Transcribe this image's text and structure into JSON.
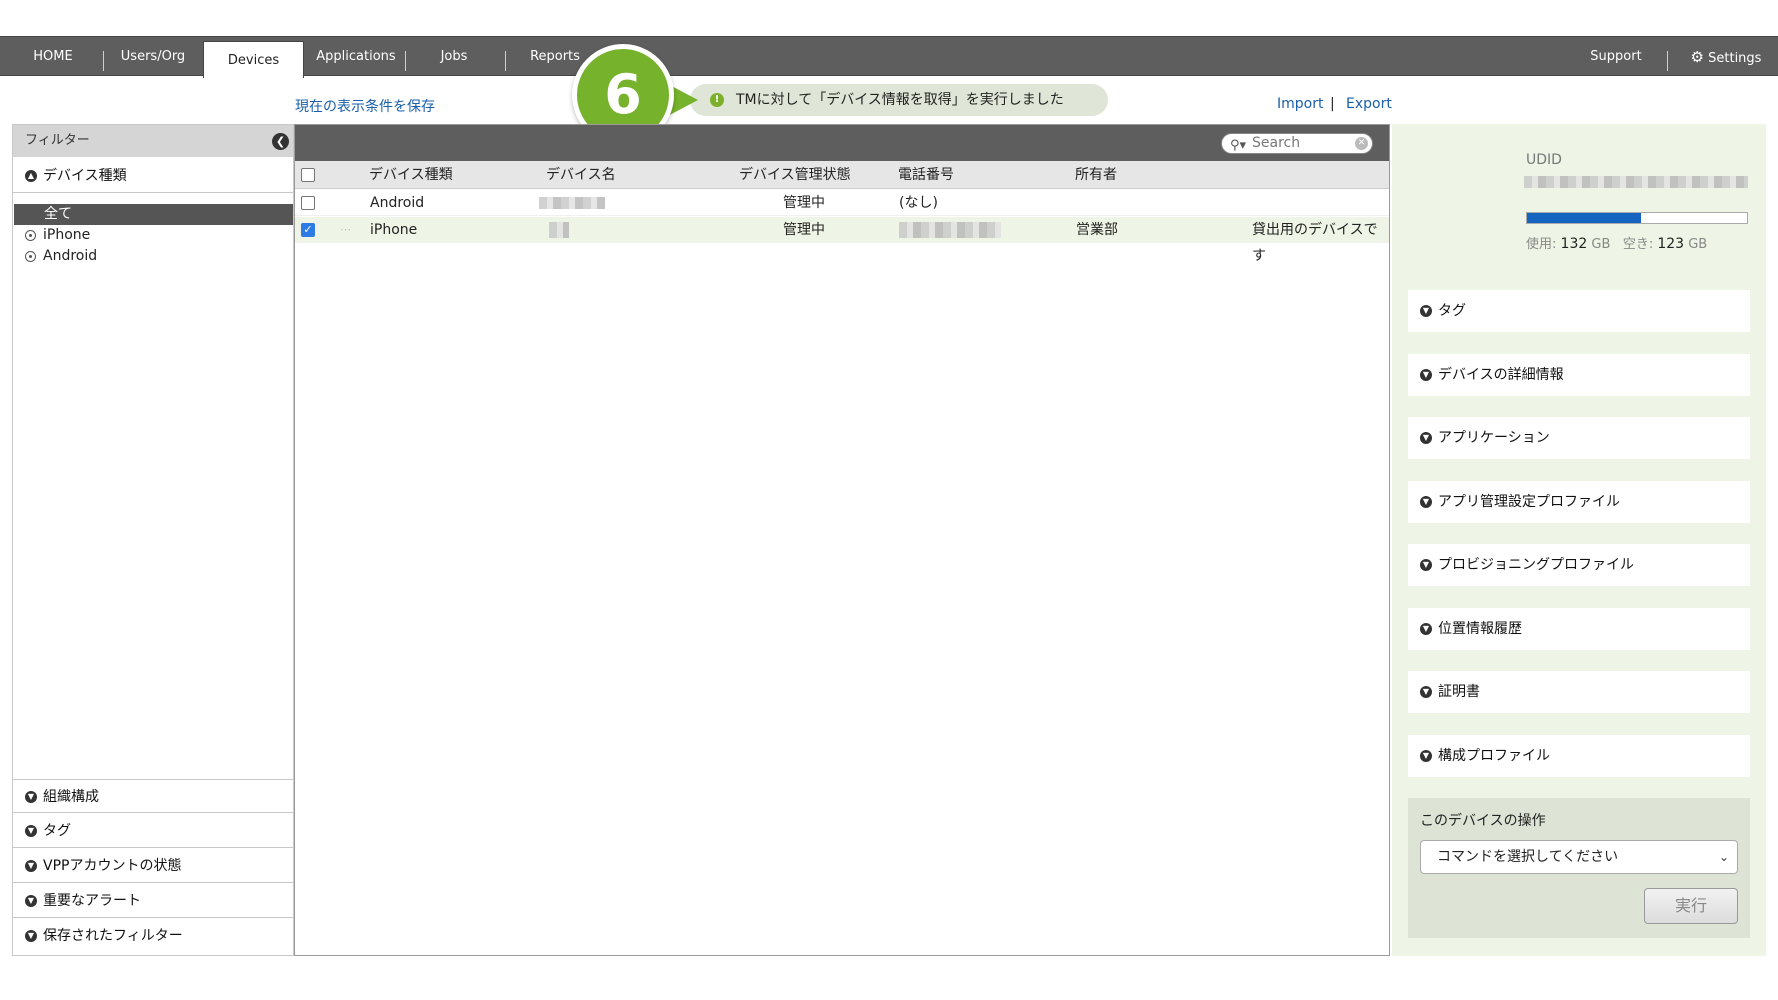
{
  "nav": {
    "items": [
      "HOME",
      "Users/Org",
      "Devices",
      "Applications",
      "Jobs",
      "Reports"
    ],
    "active": "Devices",
    "support": "Support",
    "settings": "Settings"
  },
  "save_filter_link": "現在の表示条件を保存",
  "notice": {
    "step": "6",
    "text": "TMに対して「デバイス情報を取得」を実行しました"
  },
  "import_label": "Import",
  "export_label": "Export",
  "link_sep": "|",
  "sidebar": {
    "title": "フィルター",
    "device_type_label": "デバイス種類",
    "filters": [
      "全て",
      "iPhone",
      "Android"
    ],
    "selected_filter": "全て",
    "sections": [
      "組織構成",
      "タグ",
      "VPPアカウントの状態",
      "重要なアラート",
      "保存されたフィルター"
    ]
  },
  "table": {
    "search_placeholder": "Search",
    "headers": [
      "デバイス種類",
      "デバイス名",
      "デバイス管理状態",
      "電話番号",
      "所有者"
    ],
    "rows": [
      {
        "type": "Android",
        "status": "管理中",
        "phone": "(なし)",
        "owner": "",
        "note": "",
        "checked": false
      },
      {
        "type": "iPhone",
        "status": "管理中",
        "phone": "",
        "owner": "営業部",
        "note": "貸出用のデバイスです",
        "checked": true
      }
    ]
  },
  "detail": {
    "udid_label": "UDID",
    "storage": {
      "used_label": "使用:",
      "used_value": "132",
      "free_label": "空き:",
      "free_value": "123",
      "unit": "GB",
      "used_fraction": 0.52
    },
    "accordions": [
      "タグ",
      "デバイスの詳細情報",
      "アプリケーション",
      "アプリ管理設定プロファイル",
      "プロビジョニングプロファイル",
      "位置情報履歴",
      "証明書",
      "構成プロファイル"
    ],
    "ops_title": "このデバイスの操作",
    "command_placeholder": "コマンドを選択してください",
    "execute_label": "実行"
  },
  "colors": {
    "nav_bg": "#5e5e5e",
    "accent_green": "#76b22b",
    "link_blue": "#1a5fa8",
    "storage_bar": "#1565c0",
    "panel_bg": "#eef5e6"
  },
  "icons": {
    "collapse": "chevron-left-icon",
    "expand": "chevron-down-icon",
    "settings": "gear-icon",
    "search": "search-icon",
    "notice": "exclamation-icon"
  }
}
